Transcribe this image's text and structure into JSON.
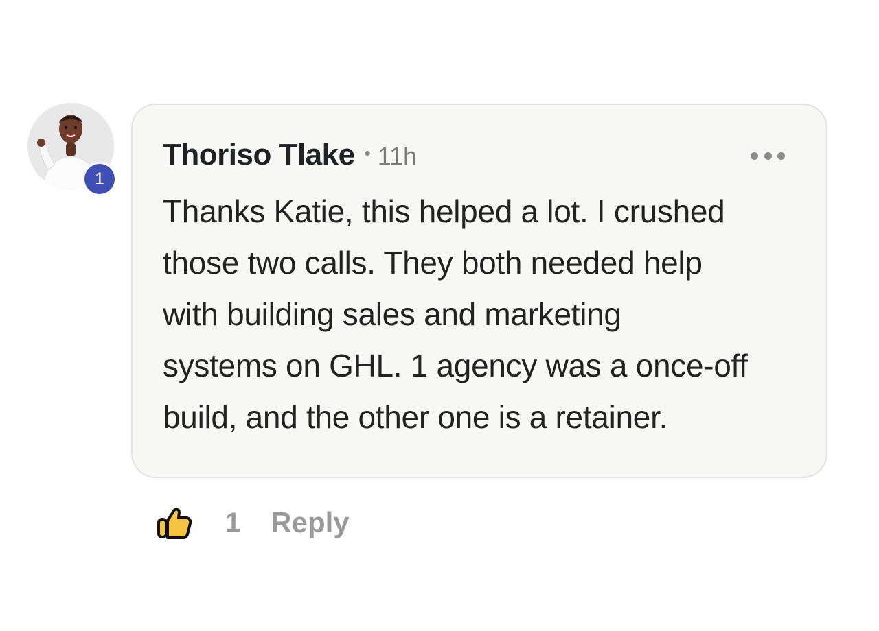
{
  "comment": {
    "author": "Thoriso Tlake",
    "separator": "•",
    "time": "11h",
    "level": "1",
    "lines": [
      "Thanks Katie, this helped a lot. I crushed",
      "those two calls. They both needed help",
      "with building sales and marketing",
      "systems on GHL. 1 agency was a once-off",
      "build, and the other one is a retainer."
    ],
    "menu_icon": "more-horizontal-icon"
  },
  "actions": {
    "like_icon": "thumbs-up-icon",
    "like_count": "1",
    "reply_label": "Reply"
  },
  "colors": {
    "badge": "#3f4fb3",
    "bubble_bg": "#f7f7f6",
    "bubble_border": "#e2e2e0",
    "like_fill": "#f6c443",
    "muted_text": "#9a9a9a"
  }
}
